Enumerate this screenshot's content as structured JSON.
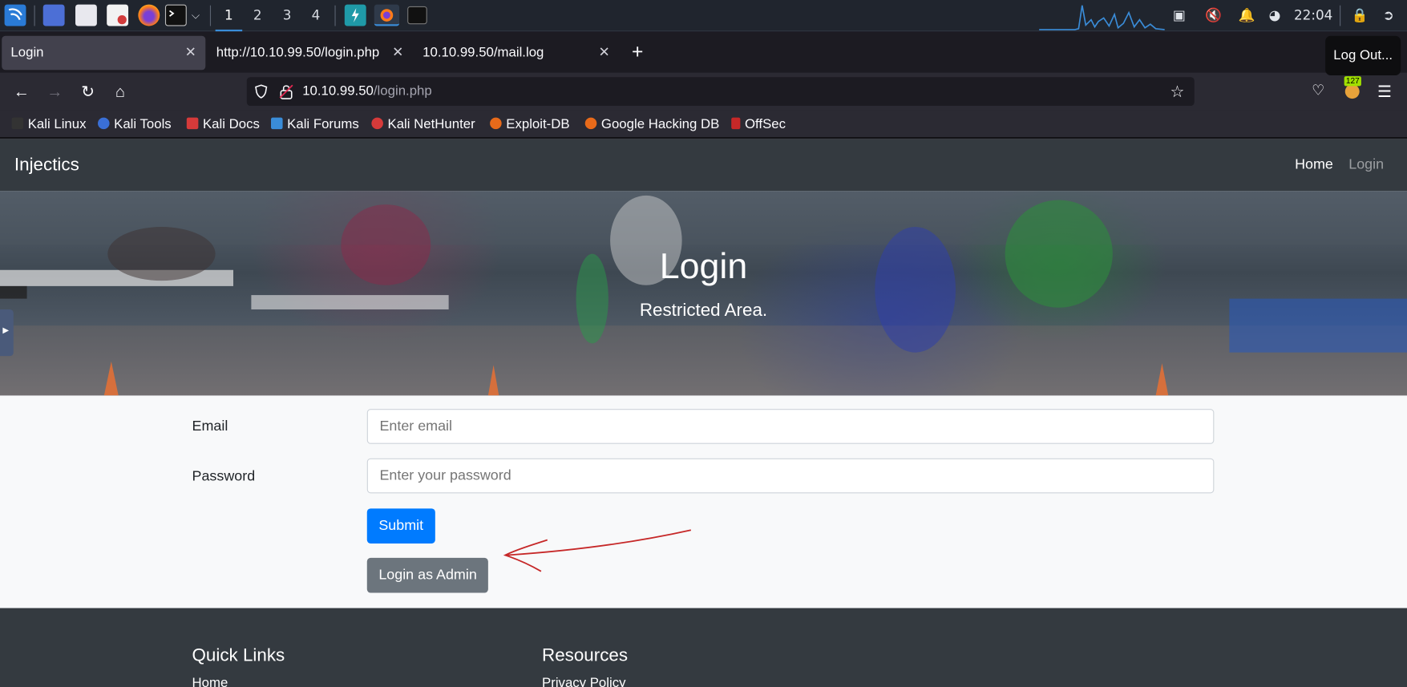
{
  "taskbar": {
    "workspaces": [
      "1",
      "2",
      "3",
      "4"
    ],
    "clock": "22:04"
  },
  "browser": {
    "tabs": [
      {
        "label": "Login"
      },
      {
        "label": "http://10.10.99.50/login.php"
      },
      {
        "label": "10.10.99.50/mail.log"
      }
    ],
    "tooltip": "Log Out...",
    "url_host": "10.10.99.50",
    "url_path": "/login.php",
    "extension_badge": "127",
    "bookmarks": [
      "Kali Linux",
      "Kali Tools",
      "Kali Docs",
      "Kali Forums",
      "Kali NetHunter",
      "Exploit-DB",
      "Google Hacking DB",
      "OffSec"
    ]
  },
  "site": {
    "brand": "Injectics",
    "nav": {
      "home": "Home",
      "login": "Login"
    },
    "hero": {
      "title": "Login",
      "subtitle": "Restricted Area."
    },
    "form": {
      "email_label": "Email",
      "email_placeholder": "Enter email",
      "password_label": "Password",
      "password_placeholder": "Enter your password",
      "submit": "Submit",
      "admin": "Login as Admin"
    },
    "footer": {
      "quick_links": "Quick Links",
      "resources": "Resources",
      "home_link": "Home",
      "privacy_link": "Privacy Policy"
    }
  },
  "colors": {
    "primary": "#007bff",
    "secondary": "#6c757d",
    "navbar": "#343a40",
    "annotation": "#c62828"
  }
}
